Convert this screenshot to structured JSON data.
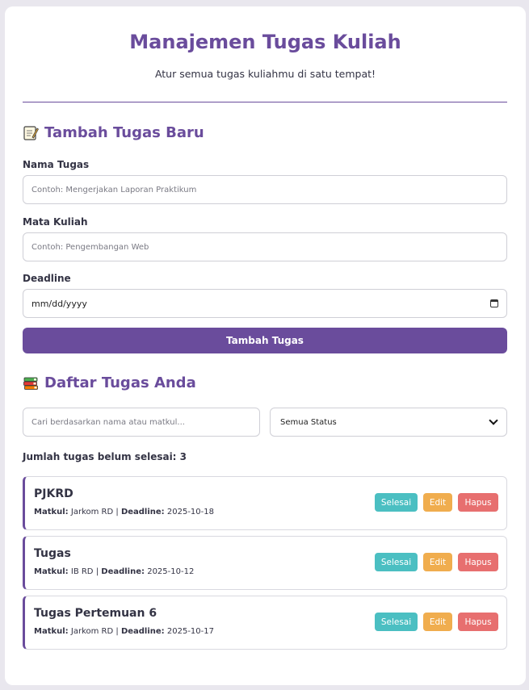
{
  "header": {
    "title": "Manajemen Tugas Kuliah",
    "subtitle": "Atur semua tugas kuliahmu di satu tempat!"
  },
  "add_section": {
    "title": "Tambah Tugas Baru",
    "icon": "memo-icon",
    "name_label": "Nama Tugas",
    "name_placeholder": "Contoh: Mengerjakan Laporan Praktikum",
    "course_label": "Mata Kuliah",
    "course_placeholder": "Contoh: Pengembangan Web",
    "deadline_label": "Deadline",
    "deadline_placeholder": "mm/dd/yyyy",
    "submit_label": "Tambah Tugas"
  },
  "list_section": {
    "title": "Daftar Tugas Anda",
    "icon": "books-icon",
    "search_placeholder": "Cari berdasarkan nama atau matkul...",
    "status_filter": "Semua Status",
    "pending_count_text": "Jumlah tugas belum selesai: 3"
  },
  "task_labels": {
    "course": "Matkul:",
    "deadline": "Deadline:",
    "sep": "|",
    "done_btn": "Selesai",
    "edit_btn": "Edit",
    "delete_btn": "Hapus"
  },
  "tasks": [
    {
      "name": "PJKRD",
      "course": "Jarkom RD",
      "deadline": "2025-10-18"
    },
    {
      "name": "Tugas",
      "course": "IB RD",
      "deadline": "2025-10-12"
    },
    {
      "name": "Tugas Pertemuan 6",
      "course": "Jarkom RD",
      "deadline": "2025-10-17"
    }
  ],
  "colors": {
    "accent": "#6a4c9c",
    "done": "#4bbfc2",
    "edit": "#f0ad4e",
    "delete": "#e76f6f"
  }
}
